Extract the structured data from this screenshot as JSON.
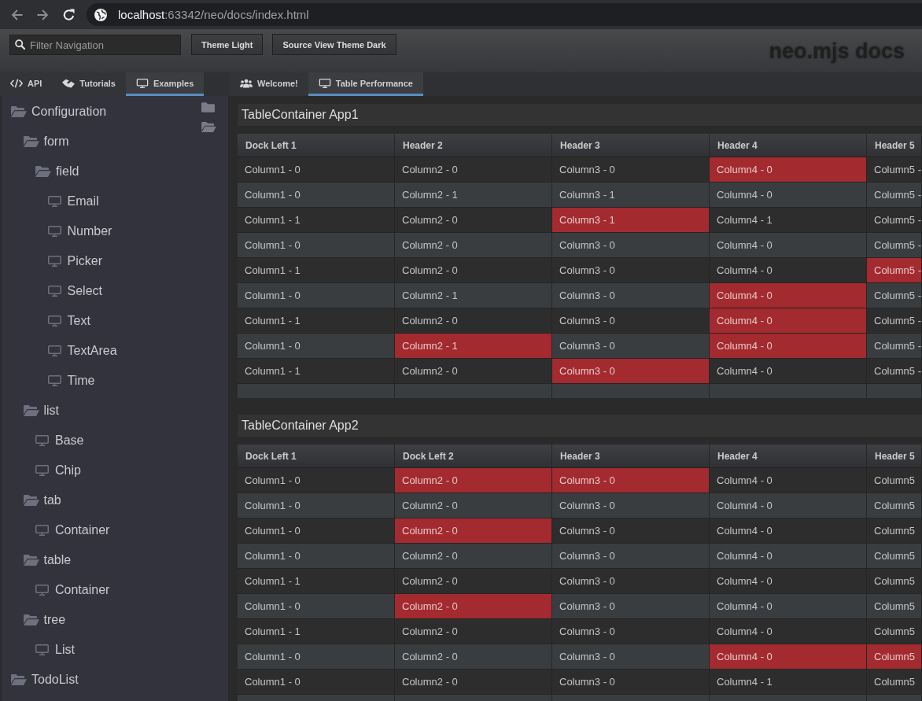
{
  "browser": {
    "address": {
      "host": "localhost",
      "path": ":63342/neo/docs/index.html"
    }
  },
  "header": {
    "filter": {
      "placeholder": "Filter Navigation"
    },
    "buttons": [
      "Theme Light",
      "Source View Theme Dark"
    ],
    "logo": "neo.mjs docs"
  },
  "sidebar": {
    "tabs": [
      {
        "label": "API",
        "selected": false
      },
      {
        "label": "Tutorials",
        "selected": false
      },
      {
        "label": "Examples",
        "selected": true
      }
    ],
    "tree": [
      {
        "label": "Configuration",
        "kind": "folder",
        "expanded": true,
        "children": [
          {
            "label": "form",
            "kind": "folder",
            "expanded": true,
            "children": [
              {
                "label": "field",
                "kind": "folder",
                "expanded": true,
                "children": [
                  {
                    "label": "Email",
                    "kind": "example"
                  },
                  {
                    "label": "Number",
                    "kind": "example"
                  },
                  {
                    "label": "Picker",
                    "kind": "example"
                  },
                  {
                    "label": "Select",
                    "kind": "example"
                  },
                  {
                    "label": "Text",
                    "kind": "example"
                  },
                  {
                    "label": "TextArea",
                    "kind": "example"
                  },
                  {
                    "label": "Time",
                    "kind": "example"
                  }
                ]
              }
            ]
          },
          {
            "label": "list",
            "kind": "folder",
            "expanded": true,
            "children": [
              {
                "label": "Base",
                "kind": "example"
              },
              {
                "label": "Chip",
                "kind": "example"
              }
            ]
          },
          {
            "label": "tab",
            "kind": "folder",
            "expanded": true,
            "children": [
              {
                "label": "Container",
                "kind": "example"
              }
            ]
          },
          {
            "label": "table",
            "kind": "folder",
            "expanded": true,
            "children": [
              {
                "label": "Container",
                "kind": "example"
              }
            ]
          },
          {
            "label": "tree",
            "kind": "folder",
            "expanded": true,
            "children": [
              {
                "label": "List",
                "kind": "example"
              }
            ]
          }
        ]
      },
      {
        "label": "TodoList",
        "kind": "folder",
        "expanded": true
      }
    ]
  },
  "main": {
    "tabs": [
      {
        "label": "Welcome!",
        "selected": false
      },
      {
        "label": "Table Performance",
        "selected": true
      }
    ],
    "tables": [
      {
        "title": "TableContainer App1",
        "columns": [
          "Dock Left 1",
          "Header 2",
          "Header 3",
          "Header 4",
          "Header 5"
        ],
        "rows": [
          [
            {
              "text": "Column1 - 0",
              "highlighted": false
            },
            {
              "text": "Column2 - 0",
              "highlighted": false
            },
            {
              "text": "Column3 - 0",
              "highlighted": false
            },
            {
              "text": "Column4 - 0",
              "highlighted": true
            },
            {
              "text": "Column5 -",
              "highlighted": false
            }
          ],
          [
            {
              "text": "Column1 - 0",
              "highlighted": false
            },
            {
              "text": "Column2 - 1",
              "highlighted": false
            },
            {
              "text": "Column3 - 1",
              "highlighted": false
            },
            {
              "text": "Column4 - 0",
              "highlighted": false
            },
            {
              "text": "Column5 -",
              "highlighted": false
            }
          ],
          [
            {
              "text": "Column1 - 1",
              "highlighted": false
            },
            {
              "text": "Column2 - 0",
              "highlighted": false
            },
            {
              "text": "Column3 - 1",
              "highlighted": true
            },
            {
              "text": "Column4 - 1",
              "highlighted": false
            },
            {
              "text": "Column5 -",
              "highlighted": false
            }
          ],
          [
            {
              "text": "Column1 - 0",
              "highlighted": false
            },
            {
              "text": "Column2 - 0",
              "highlighted": false
            },
            {
              "text": "Column3 - 0",
              "highlighted": false
            },
            {
              "text": "Column4 - 0",
              "highlighted": false
            },
            {
              "text": "Column5 -",
              "highlighted": false
            }
          ],
          [
            {
              "text": "Column1 - 1",
              "highlighted": false
            },
            {
              "text": "Column2 - 0",
              "highlighted": false
            },
            {
              "text": "Column3 - 0",
              "highlighted": false
            },
            {
              "text": "Column4 - 0",
              "highlighted": false
            },
            {
              "text": "Column5 -",
              "highlighted": true
            }
          ],
          [
            {
              "text": "Column1 - 0",
              "highlighted": false
            },
            {
              "text": "Column2 - 1",
              "highlighted": false
            },
            {
              "text": "Column3 - 0",
              "highlighted": false
            },
            {
              "text": "Column4 - 0",
              "highlighted": true
            },
            {
              "text": "Column5 -",
              "highlighted": false
            }
          ],
          [
            {
              "text": "Column1 - 1",
              "highlighted": false
            },
            {
              "text": "Column2 - 0",
              "highlighted": false
            },
            {
              "text": "Column3 - 0",
              "highlighted": false
            },
            {
              "text": "Column4 - 0",
              "highlighted": true
            },
            {
              "text": "Column5 -",
              "highlighted": false
            }
          ],
          [
            {
              "text": "Column1 - 0",
              "highlighted": false
            },
            {
              "text": "Column2 - 1",
              "highlighted": true
            },
            {
              "text": "Column3 - 0",
              "highlighted": false
            },
            {
              "text": "Column4 - 0",
              "highlighted": true
            },
            {
              "text": "Column5 -",
              "highlighted": false
            }
          ],
          [
            {
              "text": "Column1 - 1",
              "highlighted": false
            },
            {
              "text": "Column2 - 0",
              "highlighted": false
            },
            {
              "text": "Column3 - 0",
              "highlighted": true
            },
            {
              "text": "Column4 - 0",
              "highlighted": false
            },
            {
              "text": "Column5 -",
              "highlighted": false
            }
          ]
        ]
      },
      {
        "title": "TableContainer App2",
        "columns": [
          "Dock Left 1",
          "Dock Left 2",
          "Header 3",
          "Header 4",
          "Header 5"
        ],
        "rows": [
          [
            {
              "text": "Column1 - 0",
              "highlighted": false
            },
            {
              "text": "Column2 - 0",
              "highlighted": true
            },
            {
              "text": "Column3 - 0",
              "highlighted": true
            },
            {
              "text": "Column4 - 0",
              "highlighted": false
            },
            {
              "text": "Column5",
              "highlighted": false
            }
          ],
          [
            {
              "text": "Column1 - 0",
              "highlighted": false
            },
            {
              "text": "Column2 - 0",
              "highlighted": false
            },
            {
              "text": "Column3 - 0",
              "highlighted": false
            },
            {
              "text": "Column4 - 0",
              "highlighted": false
            },
            {
              "text": "Column5",
              "highlighted": false
            }
          ],
          [
            {
              "text": "Column1 - 0",
              "highlighted": false
            },
            {
              "text": "Column2 - 0",
              "highlighted": true
            },
            {
              "text": "Column3 - 0",
              "highlighted": false
            },
            {
              "text": "Column4 - 0",
              "highlighted": false
            },
            {
              "text": "Column5",
              "highlighted": false
            }
          ],
          [
            {
              "text": "Column1 - 0",
              "highlighted": false
            },
            {
              "text": "Column2 - 0",
              "highlighted": false
            },
            {
              "text": "Column3 - 0",
              "highlighted": false
            },
            {
              "text": "Column4 - 0",
              "highlighted": false
            },
            {
              "text": "Column5",
              "highlighted": false
            }
          ],
          [
            {
              "text": "Column1 - 1",
              "highlighted": false
            },
            {
              "text": "Column2 - 0",
              "highlighted": false
            },
            {
              "text": "Column3 - 0",
              "highlighted": false
            },
            {
              "text": "Column4 - 0",
              "highlighted": false
            },
            {
              "text": "Column5",
              "highlighted": false
            }
          ],
          [
            {
              "text": "Column1 - 0",
              "highlighted": false
            },
            {
              "text": "Column2 - 0",
              "highlighted": true
            },
            {
              "text": "Column3 - 0",
              "highlighted": false
            },
            {
              "text": "Column4 - 0",
              "highlighted": false
            },
            {
              "text": "Column5",
              "highlighted": false
            }
          ],
          [
            {
              "text": "Column1 - 1",
              "highlighted": false
            },
            {
              "text": "Column2 - 0",
              "highlighted": false
            },
            {
              "text": "Column3 - 0",
              "highlighted": false
            },
            {
              "text": "Column4 - 0",
              "highlighted": false
            },
            {
              "text": "Column5",
              "highlighted": false
            }
          ],
          [
            {
              "text": "Column1 - 0",
              "highlighted": false
            },
            {
              "text": "Column2 - 0",
              "highlighted": false
            },
            {
              "text": "Column3 - 0",
              "highlighted": false
            },
            {
              "text": "Column4 - 0",
              "highlighted": true
            },
            {
              "text": "Column5",
              "highlighted": true
            }
          ],
          [
            {
              "text": "Column1 - 0",
              "highlighted": false
            },
            {
              "text": "Column2 - 0",
              "highlighted": false
            },
            {
              "text": "Column3 - 0",
              "highlighted": false
            },
            {
              "text": "Column4 - 1",
              "highlighted": false
            },
            {
              "text": "Column5",
              "highlighted": false
            }
          ]
        ]
      }
    ]
  }
}
